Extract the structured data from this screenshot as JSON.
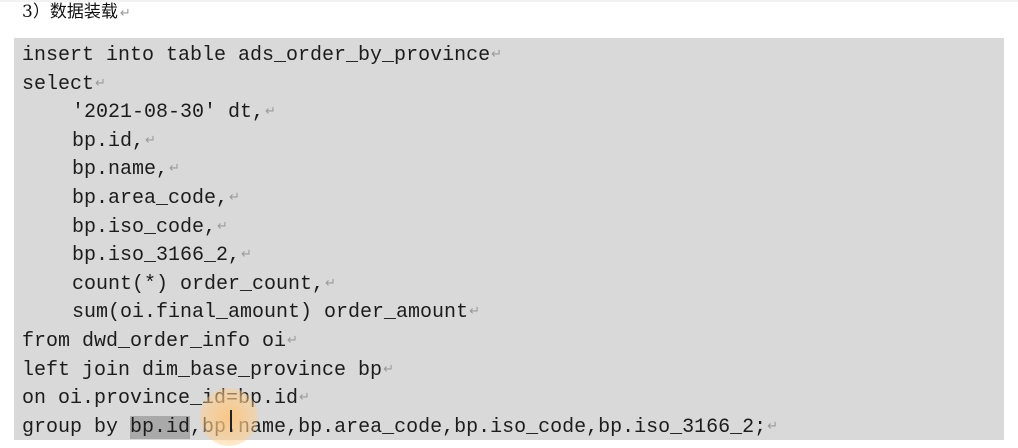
{
  "heading": {
    "text": "3）数据装载",
    "para_mark": "↵"
  },
  "code": {
    "para_mark": "↵",
    "lines": [
      "insert into table ads_order_by_province",
      "select",
      "'2021-08-30' dt,",
      "bp.id,",
      "bp.name,",
      "bp.area_code,",
      "bp.iso_code,",
      "bp.iso_3166_2,",
      "count(*) order_count,",
      "sum(oi.final_amount) order_amount",
      "from dwd_order_info oi",
      "left join dim_base_province bp",
      "on oi.province_id=bp.id"
    ],
    "last_line_selected": "bp.id",
    "last_line_prefix": "group by ",
    "last_line_rest": ",bp.name,bp.area_code,bp.iso_code,bp.iso_3166_2;"
  }
}
